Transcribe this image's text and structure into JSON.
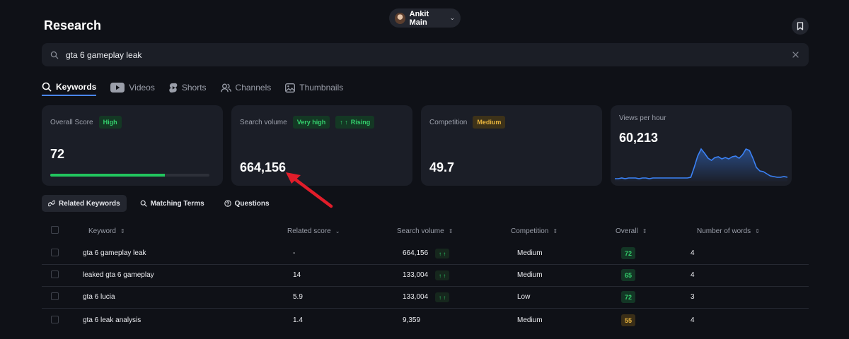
{
  "header": {
    "title": "Research",
    "user_name": "Ankit Main"
  },
  "search": {
    "value": "gta 6 gameplay leak",
    "placeholder": ""
  },
  "tabs": [
    {
      "label": "Keywords",
      "icon": "search-icon",
      "active": true
    },
    {
      "label": "Videos",
      "icon": "youtube-icon",
      "active": false
    },
    {
      "label": "Shorts",
      "icon": "shorts-icon",
      "active": false
    },
    {
      "label": "Channels",
      "icon": "users-icon",
      "active": false
    },
    {
      "label": "Thumbnails",
      "icon": "image-icon",
      "active": false
    }
  ],
  "cards": {
    "overall": {
      "label": "Overall Score",
      "badge": "High",
      "value": "72",
      "progress_percent": 72
    },
    "search_volume": {
      "label": "Search volume",
      "badge": "Very high",
      "trend_badge": "Rising",
      "value": "664,156"
    },
    "competition": {
      "label": "Competition",
      "badge": "Medium",
      "value": "49.7"
    },
    "views_per_hour": {
      "label": "Views per hour",
      "value": "60,213",
      "sparkline": [
        2,
        2,
        3,
        2,
        3,
        3,
        3,
        2,
        3,
        3,
        2,
        3,
        3,
        3,
        3,
        3,
        3,
        3,
        3,
        3,
        3,
        3,
        4,
        18,
        34,
        44,
        38,
        31,
        28,
        32,
        33,
        30,
        32,
        30,
        33,
        34,
        31,
        36,
        44,
        42,
        31,
        18,
        13,
        12,
        9,
        6,
        5,
        4,
        4,
        5,
        4
      ]
    }
  },
  "subtabs": [
    {
      "label": "Related Keywords",
      "icon": "link-icon",
      "active": true
    },
    {
      "label": "Matching Terms",
      "icon": "search-icon",
      "active": false
    },
    {
      "label": "Questions",
      "icon": "question-icon",
      "active": false
    }
  ],
  "table": {
    "columns": [
      "Keyword",
      "Related score",
      "Search volume",
      "Competition",
      "Overall",
      "Number of words"
    ],
    "rows": [
      {
        "keyword": "gta 6 gameplay leak",
        "related_score": "-",
        "search_volume": "664,156",
        "trend": true,
        "competition": "Medium",
        "overall": "72",
        "overall_level": "green",
        "words": "4"
      },
      {
        "keyword": "leaked gta 6 gameplay",
        "related_score": "14",
        "search_volume": "133,004",
        "trend": true,
        "competition": "Medium",
        "overall": "65",
        "overall_level": "green",
        "words": "4"
      },
      {
        "keyword": "gta 6 lucia",
        "related_score": "5.9",
        "search_volume": "133,004",
        "trend": true,
        "competition": "Low",
        "overall": "72",
        "overall_level": "green",
        "words": "3"
      },
      {
        "keyword": "gta 6 leak analysis",
        "related_score": "1.4",
        "search_volume": "9,359",
        "trend": false,
        "competition": "Medium",
        "overall": "55",
        "overall_level": "amber",
        "words": "4"
      }
    ]
  },
  "colors": {
    "accent": "#4a86ff",
    "green": "#22c55e",
    "amber": "#e8b43d",
    "annotation": "#e11d2a"
  }
}
